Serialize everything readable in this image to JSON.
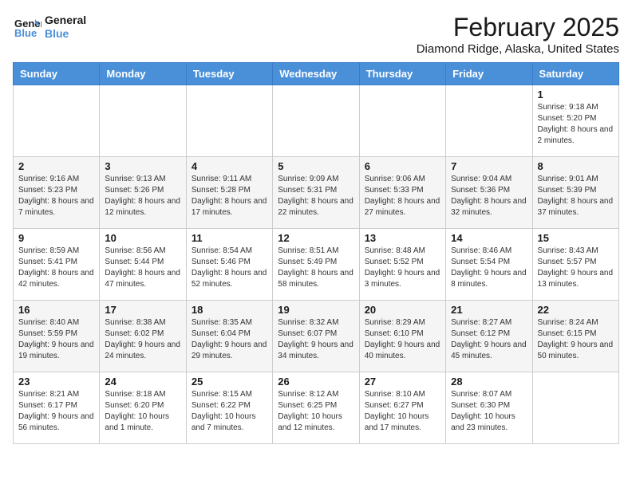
{
  "header": {
    "logo_line1": "General",
    "logo_line2": "Blue",
    "month_title": "February 2025",
    "location": "Diamond Ridge, Alaska, United States"
  },
  "weekdays": [
    "Sunday",
    "Monday",
    "Tuesday",
    "Wednesday",
    "Thursday",
    "Friday",
    "Saturday"
  ],
  "weeks": [
    [
      {
        "day": "",
        "info": ""
      },
      {
        "day": "",
        "info": ""
      },
      {
        "day": "",
        "info": ""
      },
      {
        "day": "",
        "info": ""
      },
      {
        "day": "",
        "info": ""
      },
      {
        "day": "",
        "info": ""
      },
      {
        "day": "1",
        "info": "Sunrise: 9:18 AM\nSunset: 5:20 PM\nDaylight: 8 hours and 2 minutes."
      }
    ],
    [
      {
        "day": "2",
        "info": "Sunrise: 9:16 AM\nSunset: 5:23 PM\nDaylight: 8 hours and 7 minutes."
      },
      {
        "day": "3",
        "info": "Sunrise: 9:13 AM\nSunset: 5:26 PM\nDaylight: 8 hours and 12 minutes."
      },
      {
        "day": "4",
        "info": "Sunrise: 9:11 AM\nSunset: 5:28 PM\nDaylight: 8 hours and 17 minutes."
      },
      {
        "day": "5",
        "info": "Sunrise: 9:09 AM\nSunset: 5:31 PM\nDaylight: 8 hours and 22 minutes."
      },
      {
        "day": "6",
        "info": "Sunrise: 9:06 AM\nSunset: 5:33 PM\nDaylight: 8 hours and 27 minutes."
      },
      {
        "day": "7",
        "info": "Sunrise: 9:04 AM\nSunset: 5:36 PM\nDaylight: 8 hours and 32 minutes."
      },
      {
        "day": "8",
        "info": "Sunrise: 9:01 AM\nSunset: 5:39 PM\nDaylight: 8 hours and 37 minutes."
      }
    ],
    [
      {
        "day": "9",
        "info": "Sunrise: 8:59 AM\nSunset: 5:41 PM\nDaylight: 8 hours and 42 minutes."
      },
      {
        "day": "10",
        "info": "Sunrise: 8:56 AM\nSunset: 5:44 PM\nDaylight: 8 hours and 47 minutes."
      },
      {
        "day": "11",
        "info": "Sunrise: 8:54 AM\nSunset: 5:46 PM\nDaylight: 8 hours and 52 minutes."
      },
      {
        "day": "12",
        "info": "Sunrise: 8:51 AM\nSunset: 5:49 PM\nDaylight: 8 hours and 58 minutes."
      },
      {
        "day": "13",
        "info": "Sunrise: 8:48 AM\nSunset: 5:52 PM\nDaylight: 9 hours and 3 minutes."
      },
      {
        "day": "14",
        "info": "Sunrise: 8:46 AM\nSunset: 5:54 PM\nDaylight: 9 hours and 8 minutes."
      },
      {
        "day": "15",
        "info": "Sunrise: 8:43 AM\nSunset: 5:57 PM\nDaylight: 9 hours and 13 minutes."
      }
    ],
    [
      {
        "day": "16",
        "info": "Sunrise: 8:40 AM\nSunset: 5:59 PM\nDaylight: 9 hours and 19 minutes."
      },
      {
        "day": "17",
        "info": "Sunrise: 8:38 AM\nSunset: 6:02 PM\nDaylight: 9 hours and 24 minutes."
      },
      {
        "day": "18",
        "info": "Sunrise: 8:35 AM\nSunset: 6:04 PM\nDaylight: 9 hours and 29 minutes."
      },
      {
        "day": "19",
        "info": "Sunrise: 8:32 AM\nSunset: 6:07 PM\nDaylight: 9 hours and 34 minutes."
      },
      {
        "day": "20",
        "info": "Sunrise: 8:29 AM\nSunset: 6:10 PM\nDaylight: 9 hours and 40 minutes."
      },
      {
        "day": "21",
        "info": "Sunrise: 8:27 AM\nSunset: 6:12 PM\nDaylight: 9 hours and 45 minutes."
      },
      {
        "day": "22",
        "info": "Sunrise: 8:24 AM\nSunset: 6:15 PM\nDaylight: 9 hours and 50 minutes."
      }
    ],
    [
      {
        "day": "23",
        "info": "Sunrise: 8:21 AM\nSunset: 6:17 PM\nDaylight: 9 hours and 56 minutes."
      },
      {
        "day": "24",
        "info": "Sunrise: 8:18 AM\nSunset: 6:20 PM\nDaylight: 10 hours and 1 minute."
      },
      {
        "day": "25",
        "info": "Sunrise: 8:15 AM\nSunset: 6:22 PM\nDaylight: 10 hours and 7 minutes."
      },
      {
        "day": "26",
        "info": "Sunrise: 8:12 AM\nSunset: 6:25 PM\nDaylight: 10 hours and 12 minutes."
      },
      {
        "day": "27",
        "info": "Sunrise: 8:10 AM\nSunset: 6:27 PM\nDaylight: 10 hours and 17 minutes."
      },
      {
        "day": "28",
        "info": "Sunrise: 8:07 AM\nSunset: 6:30 PM\nDaylight: 10 hours and 23 minutes."
      },
      {
        "day": "",
        "info": ""
      }
    ]
  ]
}
